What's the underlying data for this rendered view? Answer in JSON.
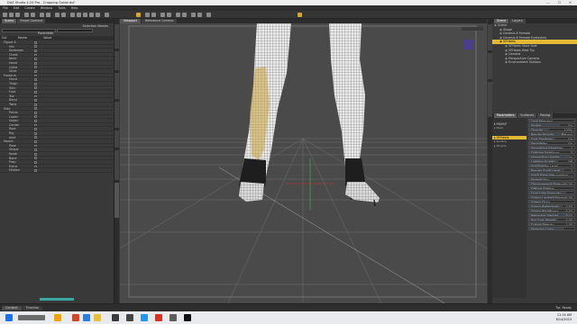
{
  "window": {
    "title": "DAZ Studio 4.20 Pro - Cropping Guide.duf",
    "controls": "— ☐ ✕"
  },
  "menu": [
    "File",
    "Edit",
    "Create",
    "Window",
    "Tools",
    "Help"
  ],
  "left_panel": {
    "tabs": [
      "Scene",
      "Smart Content"
    ],
    "selection_label": "Selection Names",
    "parameter_label": "Parameter",
    "columns": [
      "Col",
      "Name",
      "Value"
    ],
    "rows": [
      "Figure A",
      "Hip",
      "Abdomen",
      "Chest",
      "Neck",
      "Head",
      "Collar",
      "Shldr",
      "Forearm",
      "Hand",
      "Thigh",
      "Shin",
      "Foot",
      "Toe",
      "Bend",
      "Twist",
      "Side",
      "Pelvis",
      "Lower",
      "Upper",
      "Center",
      "Root",
      "Rig",
      "Joint",
      "Morph",
      "Pose",
      "Shape",
      "Node",
      "Bone",
      "Prop",
      "Extra",
      "Hidden"
    ]
  },
  "viewport": {
    "tabs": [
      "Viewport",
      "Reference Camera"
    ]
  },
  "right_panel": {
    "scene_tabs": [
      "Scene",
      "Layers"
    ],
    "scene_items": [
      {
        "label": "Scene",
        "sel": false
      },
      {
        "label": "Stage",
        "sel": false
      },
      {
        "label": "Genesis 8 Female",
        "sel": false
      },
      {
        "label": "Genesis 8 Female Eyelashes",
        "sel": false
      },
      {
        "label": "VFHeels",
        "sel": true
      },
      {
        "label": "VFHeels Shoe Sole",
        "sel": false
      },
      {
        "label": "VFHeels Heel Tip",
        "sel": false
      },
      {
        "label": "Camera",
        "sel": false
      },
      {
        "label": "Perspective Camera",
        "sel": false
      },
      {
        "label": "Environment Options",
        "sel": false
      }
    ],
    "param_tabs": [
      "Parameters",
      "Surfaces",
      "Posing"
    ],
    "params": [
      {
        "label": "Lock Selected",
        "val": ""
      },
      {
        "label": "Visible",
        "val": "On"
      },
      {
        "label": "Opacity",
        "val": "100%"
      },
      {
        "label": "Render Priority",
        "val": "Normal"
      },
      {
        "label": "Cast Shadows",
        "val": "On"
      },
      {
        "label": "Smoothing",
        "val": "On"
      },
      {
        "label": "Smoothing Iterations",
        "val": "2"
      },
      {
        "label": "Collision Iterations",
        "val": "3"
      },
      {
        "label": "Interactive Update",
        "val": "On"
      },
      {
        "label": "Lighting Quality",
        "val": "Off"
      },
      {
        "label": "SubDivision Level",
        "val": "1"
      },
      {
        "label": "Render SubD Level",
        "val": "2"
      },
      {
        "label": "SubD Edge Interpolation",
        "val": ""
      },
      {
        "label": "Normal Map",
        "val": ""
      },
      {
        "label": "Displacement Strength",
        "val": "0.00"
      },
      {
        "label": "Diffuse Overlay",
        "val": ""
      },
      {
        "label": "Dual Lobe Specular",
        "val": ""
      },
      {
        "label": "Glossy Layered Weight",
        "val": "0.00"
      },
      {
        "label": "Glossy Color",
        "val": ""
      },
      {
        "label": "Glossy Reflectivity",
        "val": "0.50"
      },
      {
        "label": "Glossy Roughness",
        "val": "0.40"
      },
      {
        "label": "Refraction Weight",
        "val": "0.00"
      },
      {
        "label": "Top Coat Weight",
        "val": "0.00"
      },
      {
        "label": "Cutout Opacity",
        "val": "1.00"
      },
      {
        "label": "Emission Color",
        "val": ""
      }
    ]
  },
  "bottom": {
    "tabs": [
      "Content",
      "Timeline"
    ],
    "status": "Tip: Ready"
  },
  "taskbar": {
    "time": "11:14 AM",
    "date": "6/14/2023"
  },
  "colors": {
    "accent": "#e3b933",
    "grid": "#9a9a9a",
    "axis_x": "#d03030",
    "axis_y": "#30b030"
  }
}
